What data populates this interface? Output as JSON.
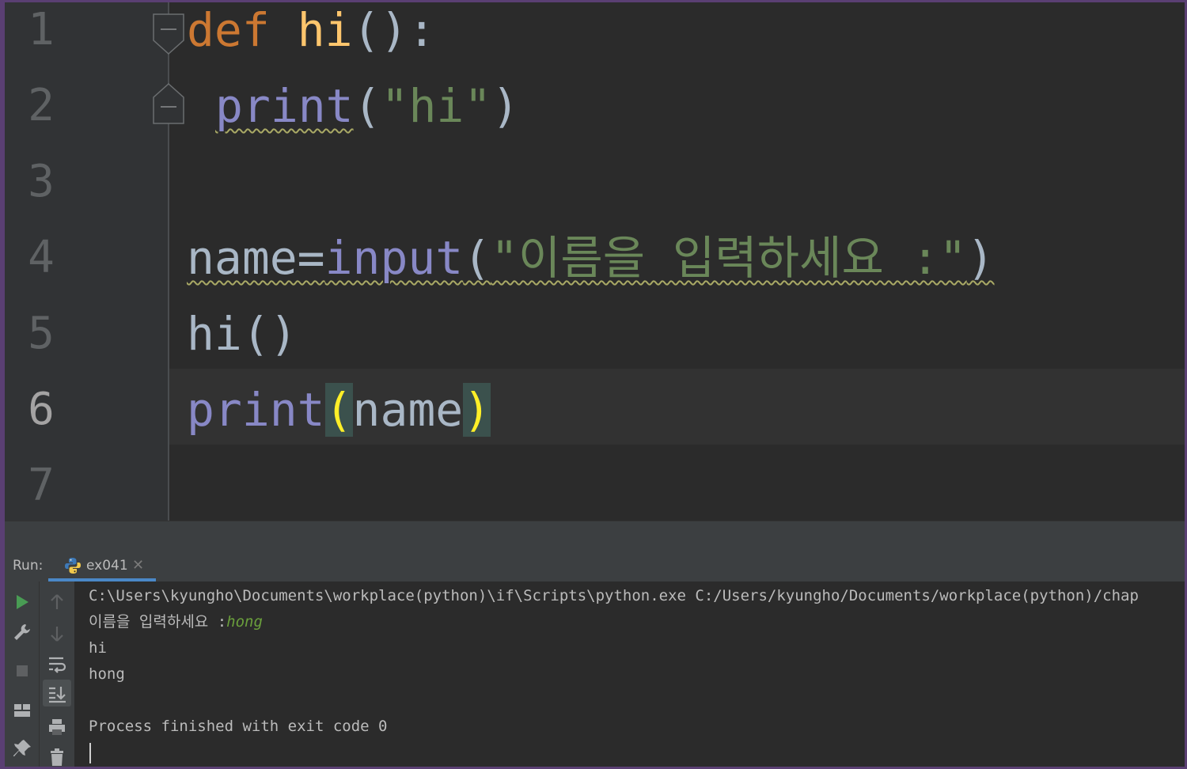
{
  "editor": {
    "line_numbers": [
      "1",
      "2",
      "3",
      "4",
      "5",
      "6",
      "7"
    ],
    "current_line": "6",
    "code": {
      "line1": {
        "kw": "def",
        "fn": "hi",
        "rest": "():"
      },
      "line2": {
        "builtin": "print",
        "open": "(",
        "str": "\"hi\"",
        "close": ")"
      },
      "line4": {
        "var": "name=",
        "builtin": "input",
        "open": "(",
        "str": "\"이름을 입력하세요 :\"",
        "close": ")"
      },
      "line5": {
        "text": "hi()"
      },
      "line6": {
        "builtin": "print",
        "open": "(",
        "arg": "name",
        "close": ")"
      }
    }
  },
  "run_panel": {
    "label": "Run:",
    "tab": {
      "name": "ex041",
      "close": "✕",
      "icon": "python-icon"
    },
    "toolbar": {
      "left": [
        "run-icon",
        "wrench-icon",
        "stop-icon",
        "layout-icon",
        "pin-icon"
      ],
      "right": [
        "arrow-up-icon",
        "arrow-down-icon",
        "soft-wrap-icon",
        "scroll-to-end-icon",
        "print-icon",
        "trash-icon"
      ]
    },
    "console": {
      "command": "C:\\Users\\kyungho\\Documents\\workplace(python)\\if\\Scripts\\python.exe C:/Users/kyungho/Documents/workplace(python)/chap",
      "prompt": "이름을 입력하세요 :",
      "user_input": "hong",
      "out1": "hi",
      "out2": "hong",
      "exit": "Process finished with exit code 0"
    }
  },
  "colors": {
    "keyword": "#cc7832",
    "function": "#ffc66d",
    "builtin": "#8888c6",
    "string": "#6a8759",
    "brace_match": "#ffef28",
    "tab_accent": "#4a88c7",
    "run_green": "#499c54"
  }
}
